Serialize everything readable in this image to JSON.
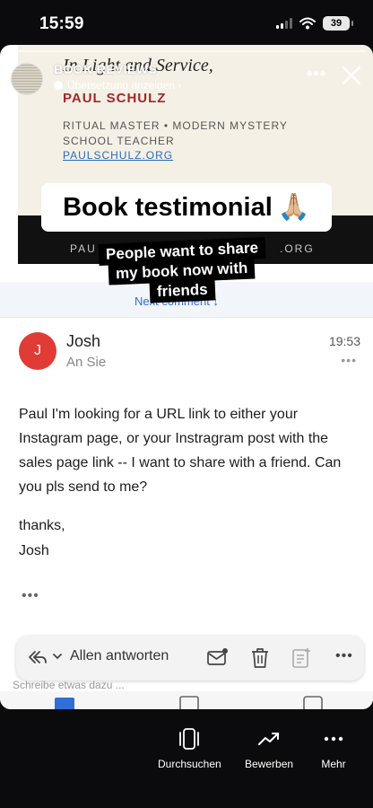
{
  "status_bar": {
    "time": "15:59",
    "battery": "39"
  },
  "story": {
    "title": "BOOK REVIEWS",
    "translate_label": "Übersetzung anzeigen ›",
    "more_label": "•••"
  },
  "promo": {
    "script_line": "In Light and Service,",
    "author": "PAUL SCHULZ",
    "role": "RITUAL MASTER • MODERN MYSTERY SCHOOL TEACHER",
    "url": "PAULSCHULZ.ORG",
    "footer_left": "PAU",
    "footer_right": ".ORG"
  },
  "overlay": {
    "testimonial": "Book testimonial",
    "testimonial_emoji": "🙏🏼",
    "caption_lines": [
      "People want to share",
      "my book now with",
      "friends"
    ]
  },
  "next_bar": {
    "label": "Next comment ↓"
  },
  "email": {
    "sender_initial": "J",
    "sender_name": "Josh",
    "recipient": "An Sie",
    "time": "19:53",
    "more": "•••",
    "body": "Paul I'm looking for a URL link to either your Instagram page, or your Instragram post with the sales page link -- I want to share with a friend. Can you pls send to me?",
    "signoff_1": "thanks,",
    "signoff_2": "Josh",
    "body_more": "•••"
  },
  "reply_bar": {
    "label": "Allen antworten",
    "more": "•••"
  },
  "reply_placeholder": "Schreibe etwas dazu ...",
  "bottom_nav": {
    "items": [
      {
        "label": "Durchsuchen",
        "icon": "phone-frame-icon"
      },
      {
        "label": "Bewerben",
        "icon": "trending-up-icon"
      },
      {
        "label": "Mehr",
        "icon": "more-dots-icon"
      }
    ]
  }
}
